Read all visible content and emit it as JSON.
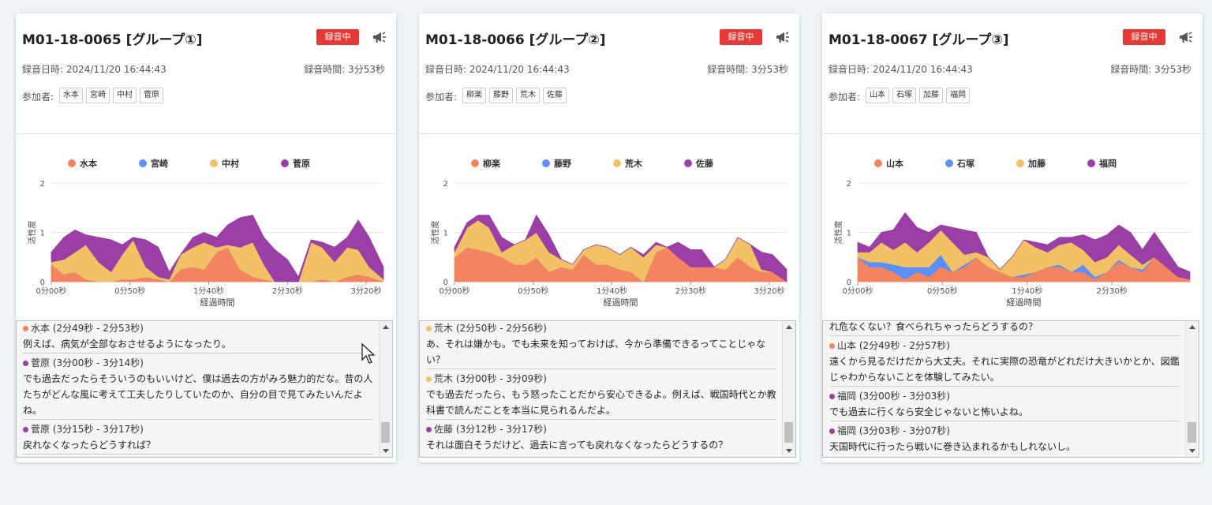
{
  "cards": [
    {
      "title": "M01-18-0065 [グループ①]",
      "rec_label": "録音中",
      "date": "録音日時: 2024/11/20 16:44:43",
      "duration": "録音時間: 3分53秒",
      "participants_label": "参加者:",
      "participants": [
        "水本",
        "宮崎",
        "中村",
        "菅原"
      ],
      "chart_data": {
        "type": "area",
        "xlabel": "経過時間",
        "ylabel": "活性度",
        "yticks": [
          "0",
          "1",
          "2"
        ],
        "xticks": [
          "0分00秒",
          "0分50秒",
          "1分40秒",
          "2分30秒",
          "3分20秒"
        ],
        "xtick_seconds": [
          0,
          50,
          100,
          150,
          200
        ],
        "ylim": [
          0,
          2
        ],
        "xlim_seconds": [
          0,
          211
        ],
        "legend_position": "top",
        "x_seconds": [
          0,
          8,
          15,
          22,
          30,
          38,
          45,
          52,
          60,
          68,
          75,
          82,
          90,
          97,
          105,
          112,
          120,
          128,
          135,
          142,
          150,
          157,
          165,
          172,
          180,
          188,
          195,
          202,
          211
        ],
        "series": [
          {
            "name": "水本",
            "color": "#f4845f",
            "values": [
              0.35,
              0.15,
              0.2,
              0.05,
              0.0,
              0.0,
              0.05,
              0.05,
              0.1,
              0.05,
              0.0,
              0.25,
              0.3,
              0.25,
              0.6,
              0.7,
              0.25,
              0.1,
              0.05,
              0.0,
              0.0,
              0.0,
              0.0,
              0.05,
              0.0,
              0.1,
              0.15,
              0.1,
              0.0
            ]
          },
          {
            "name": "宮崎",
            "color": "#5b8ff9",
            "values": [
              0,
              0,
              0,
              0,
              0,
              0,
              0,
              0,
              0,
              0,
              0,
              0,
              0,
              0,
              0,
              0,
              0,
              0,
              0,
              0,
              0,
              0,
              0,
              0,
              0,
              0,
              0,
              0,
              0
            ]
          },
          {
            "name": "中村",
            "color": "#f2c165",
            "values": [
              0.05,
              0.3,
              0.4,
              0.7,
              0.4,
              0.2,
              0.5,
              0.8,
              0.2,
              0.05,
              0.05,
              0.3,
              0.4,
              0.55,
              0.1,
              0.05,
              0.45,
              0.7,
              0.3,
              0.0,
              0.0,
              0.0,
              0.8,
              0.65,
              0.4,
              0.6,
              0.5,
              0.2,
              0.05
            ]
          },
          {
            "name": "菅原",
            "color": "#9b3ea6",
            "values": [
              0.2,
              0.45,
              0.45,
              0.2,
              0.5,
              0.65,
              0.2,
              0.05,
              0.55,
              0.6,
              0.15,
              0.0,
              0.2,
              0.2,
              0.2,
              0.4,
              0.6,
              0.55,
              0.55,
              0.65,
              0.45,
              0.1,
              0.05,
              0.1,
              0.3,
              0.2,
              0.6,
              0.6,
              0.25
            ]
          }
        ]
      },
      "transcript": [
        {
          "speaker": "水本 (2分49秒 - 2分53秒)",
          "color": "#f4845f",
          "text": "例えば、病気が全部なおさせるようになったり。"
        },
        {
          "speaker": "菅原 (3分00秒 - 3分14秒)",
          "color": "#9b3ea6",
          "text": "でも過去だったらそういうのもいいけど、僕は過去の方がみろ魅力的だな。昔の人たちがどんな風に考えて工夫したりしていたのか、自分の目で見てみたいんだよね。"
        },
        {
          "speaker": "菅原 (3分15秒 - 3分17秒)",
          "color": "#9b3ea6",
          "text": "戻れなくなったらどうすれば？"
        }
      ]
    },
    {
      "title": "M01-18-0066 [グループ②]",
      "rec_label": "録音中",
      "date": "録音日時: 2024/11/20 16:44:43",
      "duration": "録音時間: 3分53秒",
      "participants_label": "参加者:",
      "participants": [
        "柳楽",
        "藤野",
        "荒木",
        "佐藤"
      ],
      "chart_data": {
        "type": "area",
        "xlabel": "経過時間",
        "ylabel": "活性度",
        "yticks": [
          "0",
          "1",
          "2"
        ],
        "xticks": [
          "0分00秒",
          "0分50秒",
          "1分40秒",
          "2分30秒",
          "3分20秒"
        ],
        "xtick_seconds": [
          0,
          50,
          100,
          150,
          200
        ],
        "ylim": [
          0,
          2
        ],
        "xlim_seconds": [
          0,
          211
        ],
        "legend_position": "top",
        "x_seconds": [
          0,
          8,
          15,
          22,
          30,
          38,
          45,
          52,
          60,
          68,
          75,
          82,
          90,
          97,
          105,
          112,
          120,
          128,
          135,
          142,
          150,
          157,
          165,
          172,
          180,
          188,
          195,
          202,
          211
        ],
        "series": [
          {
            "name": "柳楽",
            "color": "#f4845f",
            "values": [
              0.5,
              0.7,
              0.65,
              0.6,
              0.5,
              0.35,
              0.35,
              0.5,
              0.2,
              0.3,
              0.25,
              0.55,
              0.35,
              0.35,
              0.25,
              0.2,
              0.0,
              0.6,
              0.7,
              0.5,
              0.3,
              0.3,
              0.3,
              0.25,
              0.5,
              0.3,
              0.2,
              0.2,
              0.0
            ]
          },
          {
            "name": "藤野",
            "color": "#5b8ff9",
            "values": [
              0,
              0,
              0,
              0,
              0,
              0,
              0,
              0,
              0,
              0,
              0,
              0,
              0,
              0,
              0,
              0,
              0,
              0,
              0,
              0,
              0,
              0,
              0,
              0,
              0,
              0,
              0,
              0,
              0
            ]
          },
          {
            "name": "荒木",
            "color": "#f2c165",
            "values": [
              0.1,
              0.4,
              0.6,
              0.5,
              0.1,
              0.4,
              0.5,
              0.5,
              0.4,
              0.15,
              0.1,
              0.1,
              0.4,
              0.35,
              0.3,
              0.5,
              0.5,
              0.15,
              0.0,
              0.0,
              0.0,
              0.0,
              0.0,
              0.2,
              0.4,
              0.45,
              0.05,
              0.0,
              0.0
            ]
          },
          {
            "name": "佐藤",
            "color": "#9b3ea6",
            "values": [
              0.1,
              0.1,
              0.1,
              0.25,
              0.3,
              0.0,
              0.0,
              0.35,
              0.35,
              0.0,
              0.0,
              0.0,
              0.0,
              0.0,
              0.0,
              0.0,
              0.05,
              0.05,
              0.0,
              0.3,
              0.35,
              0.35,
              0.0,
              0.0,
              0.0,
              0.0,
              0.35,
              0.35,
              0.25
            ]
          }
        ]
      },
      "transcript": [
        {
          "speaker": "荒木 (2分50秒 - 2分56秒)",
          "color": "#f2c165",
          "text": "あ、それは嫌かも。でも未来を知っておけば、今から準備できるってことじゃない？"
        },
        {
          "speaker": "荒木 (3分00秒 - 3分09秒)",
          "color": "#f2c165",
          "text": "でも過去だったら、もう怒ったことだから安心できるよ。例えば、戦国時代とか教科書で読んだことを本当に見られるんだよ。"
        },
        {
          "speaker": "佐藤 (3分12秒 - 3分17秒)",
          "color": "#9b3ea6",
          "text": "それは面白そうだけど、過去に言っても戻れなくなったらどうするの？"
        }
      ]
    },
    {
      "title": "M01-18-0067 [グループ③]",
      "rec_label": "録音中",
      "date": "録音日時: 2024/11/20 16:44:43",
      "duration": "録音時間: 3分53秒",
      "participants_label": "参加者:",
      "participants": [
        "山本",
        "石塚",
        "加藤",
        "福岡"
      ],
      "chart_data": {
        "type": "area",
        "xlabel": "経過時間",
        "ylabel": "活性度",
        "yticks": [
          "0",
          "1",
          "2"
        ],
        "xticks": [
          "0分00秒",
          "0分50秒",
          "1分40秒",
          "2分30秒"
        ],
        "xtick_seconds": [
          0,
          50,
          100,
          150
        ],
        "ylim": [
          0,
          2
        ],
        "xlim_seconds": [
          0,
          196
        ],
        "legend_position": "top",
        "x_seconds": [
          0,
          7,
          14,
          21,
          28,
          35,
          42,
          49,
          56,
          63,
          70,
          77,
          84,
          91,
          98,
          105,
          112,
          119,
          126,
          133,
          140,
          147,
          154,
          161,
          168,
          175,
          182,
          189,
          196
        ],
        "series": [
          {
            "name": "山本",
            "color": "#f4845f",
            "values": [
              0.5,
              0.3,
              0.3,
              0.2,
              0.05,
              0.2,
              0.1,
              0.3,
              0.2,
              0.3,
              0.5,
              0.3,
              0.2,
              0.1,
              0.1,
              0.2,
              0.3,
              0.3,
              0.2,
              0.2,
              0.05,
              0.2,
              0.4,
              0.3,
              0.2,
              0.5,
              0.3,
              0.1,
              0.05
            ]
          },
          {
            "name": "石塚",
            "color": "#5b8ff9",
            "values": [
              0.0,
              0.1,
              0.1,
              0.15,
              0.25,
              0.1,
              0.2,
              0.25,
              0.0,
              0.05,
              0.0,
              0.0,
              0.0,
              0.0,
              0.05,
              0.0,
              0.0,
              0.05,
              0.0,
              0.15,
              0.05,
              0.0,
              0.05,
              0.0,
              0.05,
              0.0,
              0.0,
              0.0,
              0.0
            ]
          },
          {
            "name": "加藤",
            "color": "#f2c165",
            "values": [
              0.1,
              0.2,
              0.4,
              0.3,
              0.5,
              0.3,
              0.5,
              0.5,
              0.6,
              0.2,
              0.1,
              0.2,
              0.05,
              0.4,
              0.7,
              0.5,
              0.3,
              0.4,
              0.6,
              0.3,
              0.3,
              0.3,
              0.3,
              0.25,
              0.1,
              0.0,
              0.0,
              0.0,
              0.0
            ]
          },
          {
            "name": "福岡",
            "color": "#9b3ea6",
            "values": [
              0.2,
              0.1,
              0.2,
              0.4,
              0.6,
              0.5,
              0.2,
              0.1,
              0.3,
              0.5,
              0.4,
              0.0,
              0.0,
              0.0,
              0.0,
              0.1,
              0.15,
              0.15,
              0.1,
              0.3,
              0.45,
              0.45,
              0.4,
              0.45,
              0.3,
              0.5,
              0.35,
              0.2,
              0.15
            ]
          }
        ]
      },
      "transcript": [
        {
          "speaker": "",
          "color": "",
          "text": "れ危なくない？食べられちゃったらどうするの？"
        },
        {
          "speaker": "山本 (2分49秒 - 2分57秒)",
          "color": "#f4845f",
          "text": "遠くから見るだけだから大丈夫。それに実際の恐竜がどれだけ大きいかとか、図鑑じゃわからないことを体験してみたい。"
        },
        {
          "speaker": "福岡 (3分00秒 - 3分03秒)",
          "color": "#9b3ea6",
          "text": "でも過去に行くなら安全じゃないと怖いよね。"
        },
        {
          "speaker": "福岡 (3分03秒 - 3分07秒)",
          "color": "#9b3ea6",
          "text": "天国時代に行ったら戦いに巻き込まれるかもしれないし。"
        }
      ]
    }
  ]
}
